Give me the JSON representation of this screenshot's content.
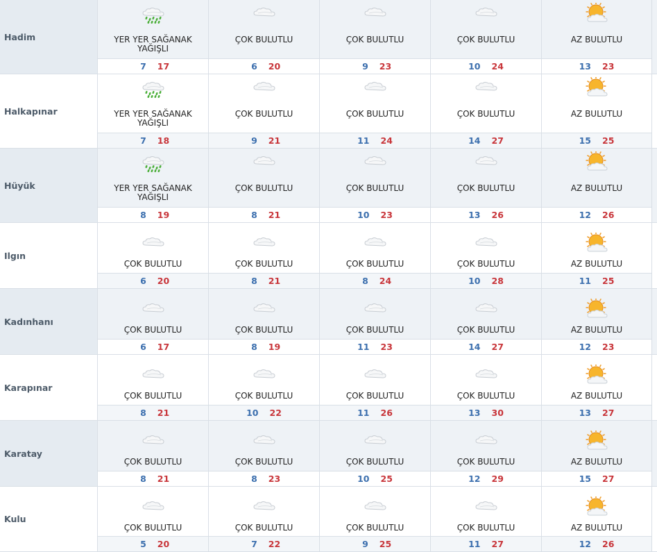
{
  "colors": {
    "min_temp": "#3c6fae",
    "max_temp": "#c8353a",
    "row_shade": "#eef2f6"
  },
  "rows": [
    {
      "name": "Hadim",
      "days": [
        {
          "icon": "rain-cloud-icon",
          "desc": "YER YER SAĞANAK YAĞIŞLI",
          "min": "7",
          "max": "17"
        },
        {
          "icon": "cloudy-icon",
          "desc": "ÇOK BULUTLU",
          "min": "6",
          "max": "20"
        },
        {
          "icon": "cloudy-icon",
          "desc": "ÇOK BULUTLU",
          "min": "9",
          "max": "23"
        },
        {
          "icon": "cloudy-icon",
          "desc": "ÇOK BULUTLU",
          "min": "10",
          "max": "24"
        },
        {
          "icon": "partly-sunny-icon",
          "desc": "AZ BULUTLU",
          "min": "13",
          "max": "23"
        }
      ]
    },
    {
      "name": "Halkapınar",
      "days": [
        {
          "icon": "rain-cloud-icon",
          "desc": "YER YER SAĞANAK YAĞIŞLI",
          "min": "7",
          "max": "18"
        },
        {
          "icon": "cloudy-icon",
          "desc": "ÇOK BULUTLU",
          "min": "9",
          "max": "21"
        },
        {
          "icon": "cloudy-icon",
          "desc": "ÇOK BULUTLU",
          "min": "11",
          "max": "24"
        },
        {
          "icon": "cloudy-icon",
          "desc": "ÇOK BULUTLU",
          "min": "14",
          "max": "27"
        },
        {
          "icon": "partly-sunny-icon",
          "desc": "AZ BULUTLU",
          "min": "15",
          "max": "25"
        }
      ]
    },
    {
      "name": "Hüyük",
      "days": [
        {
          "icon": "rain-cloud-icon",
          "desc": "YER YER SAĞANAK YAĞIŞLI",
          "min": "8",
          "max": "19"
        },
        {
          "icon": "cloudy-icon",
          "desc": "ÇOK BULUTLU",
          "min": "8",
          "max": "21"
        },
        {
          "icon": "cloudy-icon",
          "desc": "ÇOK BULUTLU",
          "min": "10",
          "max": "23"
        },
        {
          "icon": "cloudy-icon",
          "desc": "ÇOK BULUTLU",
          "min": "13",
          "max": "26"
        },
        {
          "icon": "partly-sunny-icon",
          "desc": "AZ BULUTLU",
          "min": "12",
          "max": "26"
        }
      ]
    },
    {
      "name": "Ilgın",
      "days": [
        {
          "icon": "cloudy-icon",
          "desc": "ÇOK BULUTLU",
          "min": "6",
          "max": "20"
        },
        {
          "icon": "cloudy-icon",
          "desc": "ÇOK BULUTLU",
          "min": "8",
          "max": "21"
        },
        {
          "icon": "cloudy-icon",
          "desc": "ÇOK BULUTLU",
          "min": "8",
          "max": "24"
        },
        {
          "icon": "cloudy-icon",
          "desc": "ÇOK BULUTLU",
          "min": "10",
          "max": "28"
        },
        {
          "icon": "partly-sunny-icon",
          "desc": "AZ BULUTLU",
          "min": "11",
          "max": "25"
        }
      ]
    },
    {
      "name": "Kadınhanı",
      "days": [
        {
          "icon": "cloudy-icon",
          "desc": "ÇOK BULUTLU",
          "min": "6",
          "max": "17"
        },
        {
          "icon": "cloudy-icon",
          "desc": "ÇOK BULUTLU",
          "min": "8",
          "max": "19"
        },
        {
          "icon": "cloudy-icon",
          "desc": "ÇOK BULUTLU",
          "min": "11",
          "max": "23"
        },
        {
          "icon": "cloudy-icon",
          "desc": "ÇOK BULUTLU",
          "min": "14",
          "max": "27"
        },
        {
          "icon": "partly-sunny-icon",
          "desc": "AZ BULUTLU",
          "min": "12",
          "max": "23"
        }
      ]
    },
    {
      "name": "Karapınar",
      "days": [
        {
          "icon": "cloudy-icon",
          "desc": "ÇOK BULUTLU",
          "min": "8",
          "max": "21"
        },
        {
          "icon": "cloudy-icon",
          "desc": "ÇOK BULUTLU",
          "min": "10",
          "max": "22"
        },
        {
          "icon": "cloudy-icon",
          "desc": "ÇOK BULUTLU",
          "min": "11",
          "max": "26"
        },
        {
          "icon": "cloudy-icon",
          "desc": "ÇOK BULUTLU",
          "min": "13",
          "max": "30"
        },
        {
          "icon": "partly-sunny-icon",
          "desc": "AZ BULUTLU",
          "min": "13",
          "max": "27"
        }
      ]
    },
    {
      "name": "Karatay",
      "days": [
        {
          "icon": "cloudy-icon",
          "desc": "ÇOK BULUTLU",
          "min": "8",
          "max": "21"
        },
        {
          "icon": "cloudy-icon",
          "desc": "ÇOK BULUTLU",
          "min": "8",
          "max": "23"
        },
        {
          "icon": "cloudy-icon",
          "desc": "ÇOK BULUTLU",
          "min": "10",
          "max": "25"
        },
        {
          "icon": "cloudy-icon",
          "desc": "ÇOK BULUTLU",
          "min": "12",
          "max": "29"
        },
        {
          "icon": "partly-sunny-icon",
          "desc": "AZ BULUTLU",
          "min": "15",
          "max": "27"
        }
      ]
    },
    {
      "name": "Kulu",
      "days": [
        {
          "icon": "cloudy-icon",
          "desc": "ÇOK BULUTLU",
          "min": "5",
          "max": "20"
        },
        {
          "icon": "cloudy-icon",
          "desc": "ÇOK BULUTLU",
          "min": "7",
          "max": "22"
        },
        {
          "icon": "cloudy-icon",
          "desc": "ÇOK BULUTLU",
          "min": "9",
          "max": "25"
        },
        {
          "icon": "cloudy-icon",
          "desc": "ÇOK BULUTLU",
          "min": "11",
          "max": "27"
        },
        {
          "icon": "partly-sunny-icon",
          "desc": "AZ BULUTLU",
          "min": "12",
          "max": "26"
        }
      ]
    }
  ]
}
